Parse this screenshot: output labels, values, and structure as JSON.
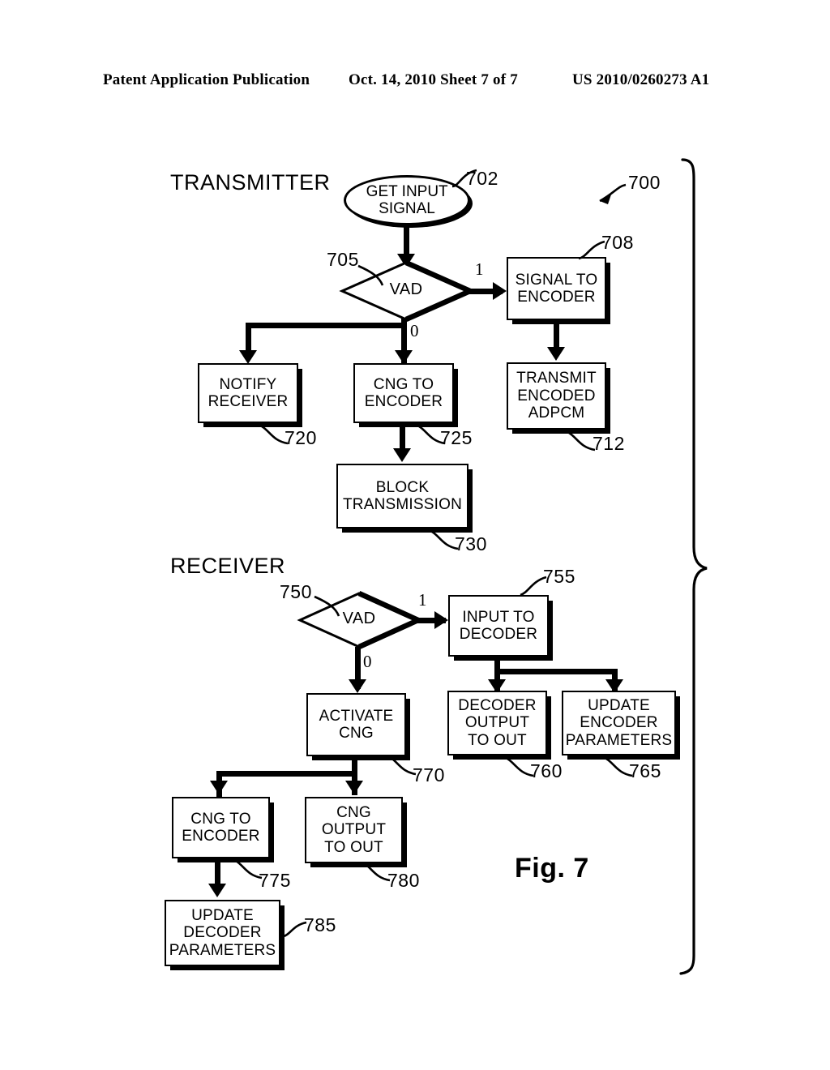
{
  "header": {
    "left": "Patent Application Publication",
    "middle": "Oct. 14, 2010  Sheet 7 of 7",
    "right": "US 2010/0260273 A1"
  },
  "figure": {
    "caption": "Fig. 7",
    "overall_ref": "700",
    "sections": [
      {
        "name": "transmitter",
        "label": "TRANSMITTER"
      },
      {
        "name": "receiver",
        "label": "RECEIVER"
      }
    ]
  },
  "flow": {
    "transmitter": {
      "start": {
        "text1": "GET INPUT",
        "text2": "SIGNAL",
        "ref": "702"
      },
      "decision": {
        "label": "VAD",
        "ref": "705",
        "branch_true": "1",
        "branch_false": "0"
      },
      "nodes": [
        {
          "id": "708",
          "lines": [
            "SIGNAL TO",
            "ENCODER"
          ],
          "ref": "708"
        },
        {
          "id": "712",
          "lines": [
            "TRANSMIT",
            "ENCODED",
            "ADPCM"
          ],
          "ref": "712"
        },
        {
          "id": "720",
          "lines": [
            "NOTIFY",
            "RECEIVER"
          ],
          "ref": "720"
        },
        {
          "id": "725",
          "lines": [
            "CNG TO",
            "ENCODER"
          ],
          "ref": "725"
        },
        {
          "id": "730",
          "lines": [
            "BLOCK",
            "TRANSMISSION"
          ],
          "ref": "730"
        }
      ]
    },
    "receiver": {
      "decision": {
        "label": "VAD",
        "ref": "750",
        "branch_true": "1",
        "branch_false": "0"
      },
      "nodes": [
        {
          "id": "755",
          "lines": [
            "INPUT TO",
            "DECODER"
          ],
          "ref": "755"
        },
        {
          "id": "760",
          "lines": [
            "DECODER",
            "OUTPUT",
            "TO OUT"
          ],
          "ref": "760"
        },
        {
          "id": "765",
          "lines": [
            "UPDATE",
            "ENCODER",
            "PARAMETERS"
          ],
          "ref": "765"
        },
        {
          "id": "770",
          "lines": [
            "ACTIVATE",
            "CNG"
          ],
          "ref": "770"
        },
        {
          "id": "775",
          "lines": [
            "CNG TO",
            "ENCODER"
          ],
          "ref": "775"
        },
        {
          "id": "780",
          "lines": [
            "CNG",
            "OUTPUT",
            "TO OUT"
          ],
          "ref": "780"
        },
        {
          "id": "785",
          "lines": [
            "UPDATE",
            "DECODER",
            "PARAMETERS"
          ],
          "ref": "785"
        }
      ]
    }
  },
  "colors": {
    "ink": "#000000",
    "paper": "#ffffff"
  }
}
